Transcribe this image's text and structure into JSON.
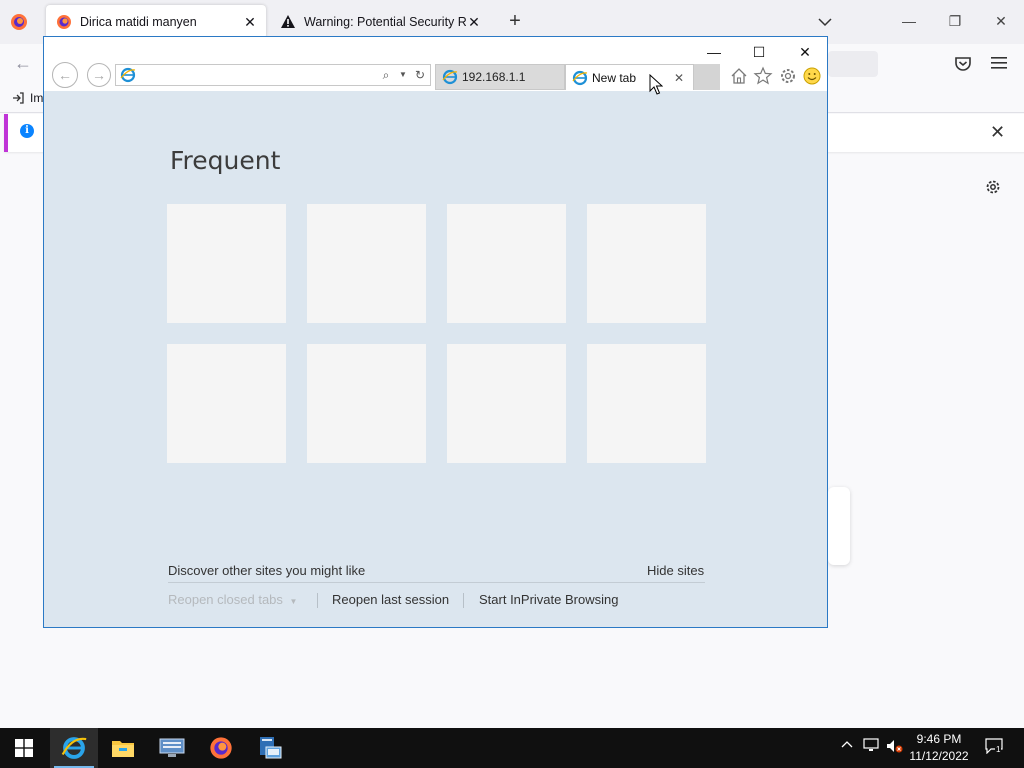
{
  "firefox": {
    "tabs": [
      {
        "title": "Dirica matidi manyen",
        "active": true
      },
      {
        "title": "Warning: Potential Security Risk",
        "active": false
      }
    ],
    "bookmarks": {
      "import_label": "Im"
    },
    "info_icon": "i"
  },
  "ie": {
    "address": {
      "value": "",
      "placeholder": ""
    },
    "tabs": [
      {
        "title": "192.168.1.1",
        "active": false
      },
      {
        "title": "New tab",
        "active": true
      }
    ],
    "content": {
      "heading": "Frequent",
      "tile_count": 8,
      "discover_label": "Discover other sites you might like",
      "hide_label": "Hide sites",
      "reopen_closed_label": "Reopen closed tabs",
      "reopen_last_label": "Reopen last session",
      "inprivate_label": "Start InPrivate Browsing"
    }
  },
  "taskbar": {
    "items": [
      "start-icon",
      "internet-explorer-icon",
      "file-explorer-icon",
      "server-manager-icon",
      "firefox-icon",
      "remote-desktop-icon"
    ],
    "active_item": "internet-explorer-icon",
    "time": "9:46 PM",
    "date": "11/12/2022",
    "notification_count": "1"
  },
  "colors": {
    "ie_background": "#dce6ef",
    "ie_border": "#2b79c5",
    "taskbar": "#101010",
    "info_accent": "#c034d7",
    "info_icon": "#0a84ff"
  }
}
